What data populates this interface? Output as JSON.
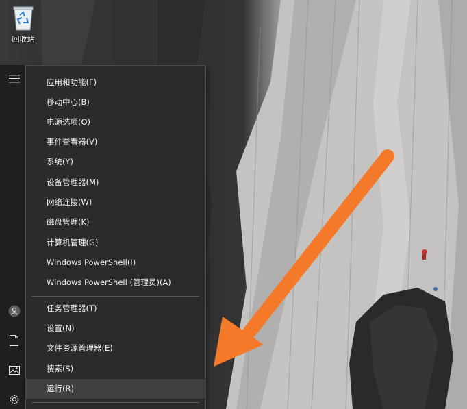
{
  "desktop": {
    "recycle_bin_label": "回收站"
  },
  "start_rail": {
    "icons": [
      "hamburger-menu-icon",
      "user-avatar-icon",
      "document-icon",
      "pictures-icon",
      "settings-icon"
    ]
  },
  "menu": {
    "group1": [
      "应用和功能(F)",
      "移动中心(B)",
      "电源选项(O)",
      "事件查看器(V)",
      "系统(Y)",
      "设备管理器(M)",
      "网络连接(W)",
      "磁盘管理(K)",
      "计算机管理(G)",
      "Windows PowerShell(I)",
      "Windows PowerShell (管理员)(A)"
    ],
    "group2": [
      "任务管理器(T)",
      "设置(N)",
      "文件资源管理器(E)",
      "搜索(S)",
      "运行(R)"
    ],
    "highlighted_item": "运行(R)"
  },
  "colors": {
    "menu_background": "#2b2b2b",
    "menu_text": "#f2f2f2",
    "highlight": "#414141",
    "arrow": "#f47a2a"
  }
}
